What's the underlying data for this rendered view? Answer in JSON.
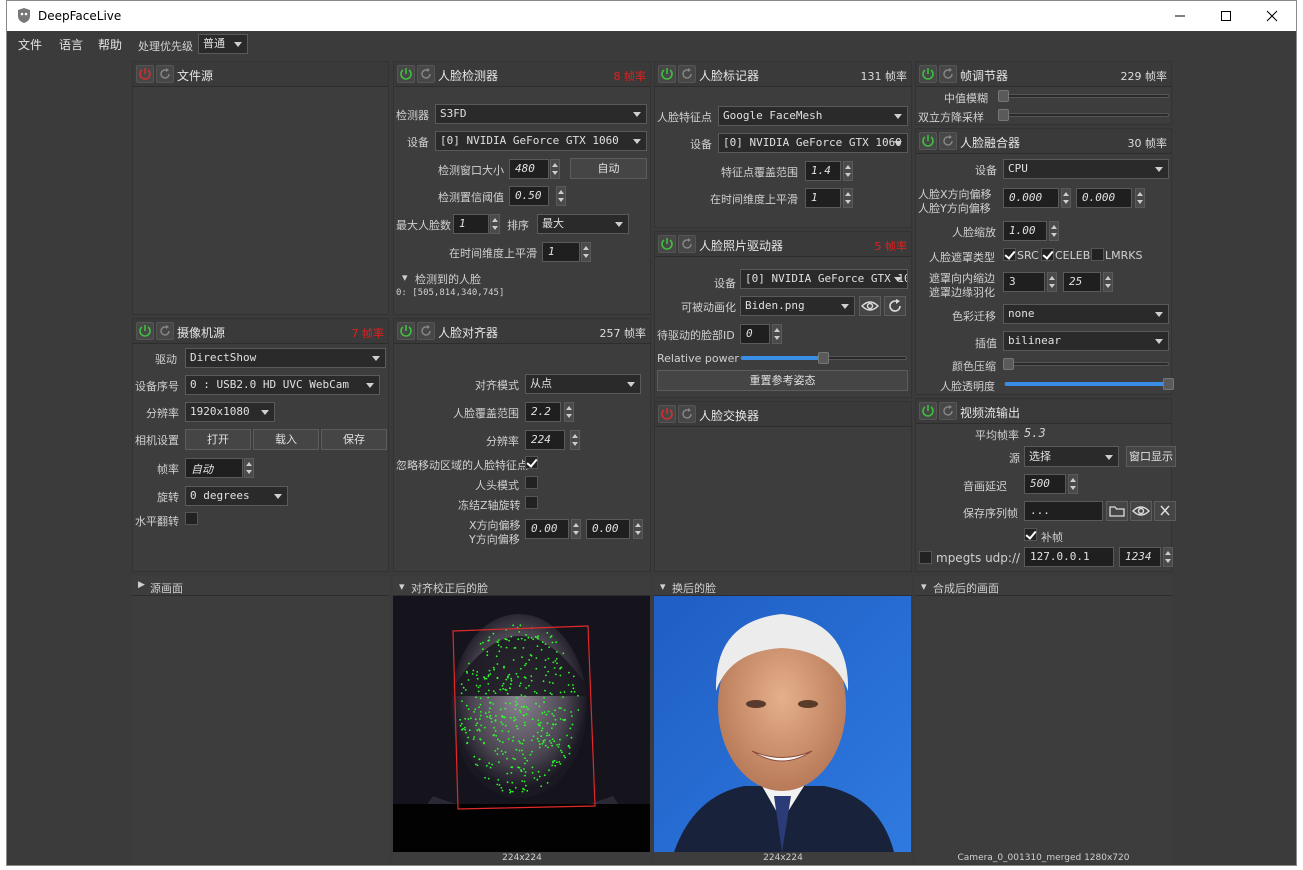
{
  "app": {
    "title": "DeepFaceLive"
  },
  "menu": {
    "file": "文件",
    "language": "语言",
    "help": "帮助",
    "priority_label": "处理优先级",
    "priority_value": "普通"
  },
  "file_source": {
    "title": "文件源"
  },
  "camera_source": {
    "title": "摄像机源",
    "fps": "7 帧率",
    "driver_label": "驱动",
    "driver_value": "DirectShow",
    "device_label": "设备序号",
    "device_value": "0 : USB2.0 HD UVC WebCam",
    "resolution_label": "分辨率",
    "resolution_value": "1920x1080",
    "settings_label": "相机设置",
    "open_btn": "打开",
    "load_btn": "载入",
    "save_btn": "保存",
    "fps_label": "帧率",
    "fps_value": "自动",
    "rotation_label": "旋转",
    "rotation_value": "0 degrees",
    "flip_label": "水平翻转"
  },
  "face_detector": {
    "title": "人脸检测器",
    "fps": "8 帧率",
    "detector_label": "检测器",
    "detector_value": "S3FD",
    "device_label": "设备",
    "device_value": "[0] NVIDIA GeForce GTX 1060",
    "window_label": "检测窗口大小",
    "window_value": "480",
    "auto_btn": "自动",
    "threshold_label": "检测置信阈值",
    "threshold_value": "0.50",
    "maxfaces_label": "最大人脸数",
    "maxfaces_value": "1",
    "sort_label": "排序",
    "sort_value": "最大",
    "smooth_label": "在时间维度上平滑",
    "smooth_value": "1",
    "detected_label": "检测到的人脸",
    "detected_value": "0: [505,814,340,745]"
  },
  "face_aligner": {
    "title": "人脸对齐器",
    "fps": "257 帧率",
    "mode_label": "对齐模式",
    "mode_value": "从点",
    "coverage_label": "人脸覆盖范围",
    "coverage_value": "2.2",
    "resolution_label": "分辨率",
    "resolution_value": "224",
    "exclude_label": "忽略移动区域的人脸特征点",
    "head_label": "人头模式",
    "freeze_label": "冻结Z轴旋转",
    "xoff_label": "X方向偏移",
    "yoff_label": "Y方向偏移",
    "xoff_value": "0.00",
    "yoff_value": "0.00"
  },
  "face_marker": {
    "title": "人脸标记器",
    "fps": "131 帧率",
    "landmarks_label": "人脸特征点",
    "landmarks_value": "Google FaceMesh",
    "device_label": "设备",
    "device_value": "[0] NVIDIA GeForce GTX 1060",
    "range_label": "特征点覆盖范围",
    "range_value": "1.4",
    "smooth_label": "在时间维度上平滑",
    "smooth_value": "1"
  },
  "face_animator": {
    "title": "人脸照片驱动器",
    "fps": "5 帧率",
    "device_label": "设备",
    "device_value": "[0] NVIDIA GeForce GTX 1060",
    "animatable_label": "可被动画化",
    "animatable_value": "Biden.png",
    "faceid_label": "待驱动的脸部ID",
    "faceid_value": "0",
    "power_label": "Relative power",
    "power_level": 0.5,
    "reset_btn": "重置参考姿态"
  },
  "face_swapper": {
    "title": "人脸交换器"
  },
  "frame_adjuster": {
    "title": "帧调节器",
    "fps": "229 帧率",
    "median_label": "中值模糊",
    "degrade_label": "双立方降采样"
  },
  "face_merger": {
    "title": "人脸融合器",
    "fps": "30 帧率",
    "device_label": "设备",
    "device_value": "CPU",
    "xoff_label": "人脸X方向偏移",
    "yoff_label": "人脸Y方向偏移",
    "xoff_value": "0.000",
    "yoff_value": "0.000",
    "scale_label": "人脸缩放",
    "scale_value": "1.00",
    "mask_label": "人脸遮罩类型",
    "mask_src": "SRC",
    "mask_celeb": "CELEB",
    "mask_lmrks": "LMRKS",
    "erode_label": "遮罩向内缩边",
    "blur_label": "遮罩边缘羽化",
    "erode_value": "3",
    "blur_value": "25",
    "color_label": "色彩迁移",
    "color_value": "none",
    "interp_label": "插值",
    "interp_value": "bilinear",
    "compress_label": "颜色压缩",
    "opacity_label": "人脸透明度",
    "opacity_level": 1.0
  },
  "stream_output": {
    "title": "视频流输出",
    "avgfps_label": "平均帧率",
    "avgfps_value": "5.3",
    "source_label": "源",
    "source_value": "选择",
    "window_btn": "窗口显示",
    "delay_label": "音画延迟",
    "delay_value": "500",
    "seq_label": "保存序列帧",
    "seq_value": "...",
    "fill_label": "补帧",
    "mpegts_label": "mpegts udp://",
    "ip_value": "127.0.0.1",
    "port_value": "1234"
  },
  "views": {
    "source": "源画面",
    "aligned": "对齐校正后的脸",
    "aligned_caption": "224x224",
    "swapped": "换后的脸",
    "swapped_caption": "224x224",
    "merged": "合成后的画面",
    "merged_caption": "Camera_0_001310_merged 1280x720"
  },
  "colors": {
    "accent": "#3a8ee6",
    "power_on": "#3fbf3f",
    "power_off": "#d03030",
    "fps_warn": "#e02020"
  }
}
